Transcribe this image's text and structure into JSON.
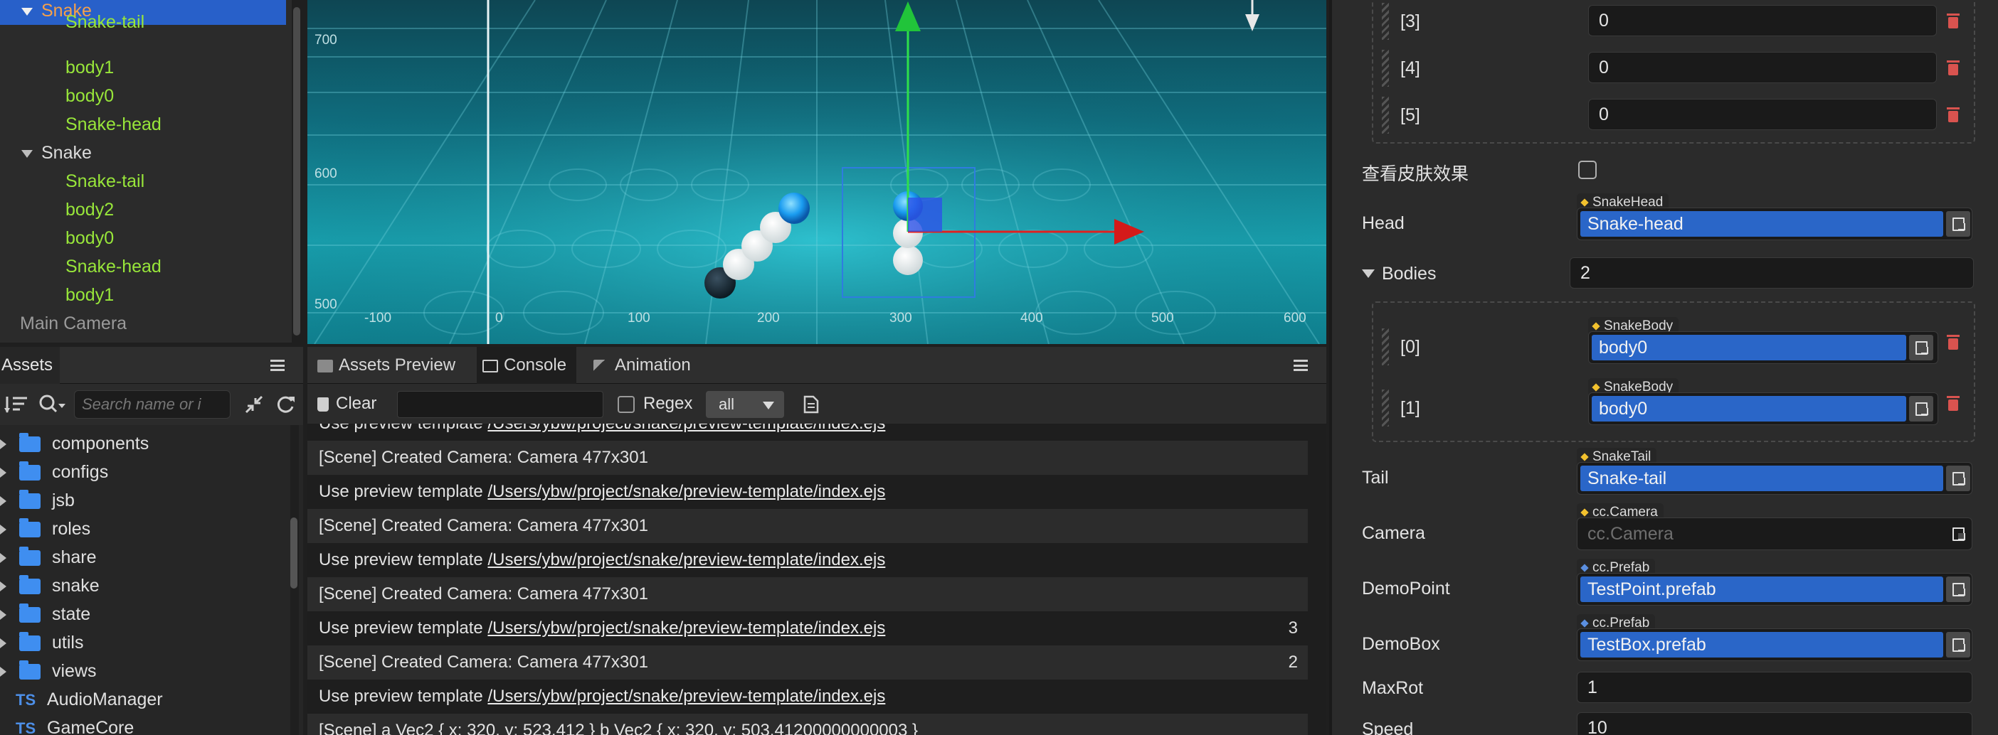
{
  "hierarchy": {
    "items": [
      {
        "label": "Snake",
        "color": "#f5a04a",
        "selected": true,
        "expanded": true
      },
      {
        "label": "Snake-tail",
        "color": "#98e63a"
      },
      {
        "label": "body1",
        "color": "#98e63a"
      },
      {
        "label": "body0",
        "color": "#98e63a"
      },
      {
        "label": "Snake-head",
        "color": "#98e63a"
      },
      {
        "label": "Snake",
        "color": "#dcdcdc",
        "expanded": true
      },
      {
        "label": "Snake-tail",
        "color": "#98e63a"
      },
      {
        "label": "body2",
        "color": "#98e63a"
      },
      {
        "label": "body0",
        "color": "#98e63a"
      },
      {
        "label": "Snake-head",
        "color": "#98e63a"
      },
      {
        "label": "body1",
        "color": "#98e63a"
      },
      {
        "label": "Main Camera",
        "color": "#9a9a9a"
      }
    ]
  },
  "scene": {
    "y_labels": [
      "700",
      "600",
      "500"
    ],
    "x_labels": [
      "-100",
      "0",
      "100",
      "200",
      "300",
      "400",
      "500",
      "600"
    ]
  },
  "assets": {
    "tab_label": "Assets",
    "search_placeholder": "Search name or i",
    "items": [
      {
        "label": "components",
        "kind": "folder"
      },
      {
        "label": "configs",
        "kind": "folder"
      },
      {
        "label": "jsb",
        "kind": "folder"
      },
      {
        "label": "roles",
        "kind": "folder"
      },
      {
        "label": "share",
        "kind": "folder"
      },
      {
        "label": "snake",
        "kind": "folder"
      },
      {
        "label": "state",
        "kind": "folder"
      },
      {
        "label": "utils",
        "kind": "folder"
      },
      {
        "label": "views",
        "kind": "folder"
      },
      {
        "label": "AudioManager",
        "kind": "ts"
      },
      {
        "label": "GameCore",
        "kind": "ts"
      }
    ],
    "ts_badge": "TS"
  },
  "console": {
    "tabs": {
      "assets_preview": "Assets Preview",
      "console": "Console",
      "animation": "Animation"
    },
    "toolbar": {
      "clear_label": "Clear",
      "regex_label": "Regex",
      "level_value": "all"
    },
    "lines": [
      {
        "text": "Use preview template ",
        "link": "/Users/ybw/project/snake/preview-template/index.ejs",
        "count": ""
      },
      {
        "text": "[Scene] Created Camera: Camera 477x301",
        "link": "",
        "count": ""
      },
      {
        "text": "Use preview template ",
        "link": "/Users/ybw/project/snake/preview-template/index.ejs",
        "count": ""
      },
      {
        "text": "[Scene] Created Camera: Camera 477x301",
        "link": "",
        "count": ""
      },
      {
        "text": "Use preview template ",
        "link": "/Users/ybw/project/snake/preview-template/index.ejs",
        "count": ""
      },
      {
        "text": "[Scene] Created Camera: Camera 477x301",
        "link": "",
        "count": ""
      },
      {
        "text": "Use preview template ",
        "link": "/Users/ybw/project/snake/preview-template/index.ejs",
        "count": "3"
      },
      {
        "text": "[Scene] Created Camera: Camera 477x301",
        "link": "",
        "count": "2"
      },
      {
        "text": "Use preview template ",
        "link": "/Users/ybw/project/snake/preview-template/index.ejs",
        "count": ""
      },
      {
        "text": "[Scene] a Vec2 { x: 320, y: 523.412 } b Vec2 { x: 320, y: 503.41200000000003 }",
        "link": "",
        "count": ""
      }
    ]
  },
  "inspector": {
    "array_items": [
      {
        "index": "[3]",
        "value": "0"
      },
      {
        "index": "[4]",
        "value": "0"
      },
      {
        "index": "[5]",
        "value": "0"
      }
    ],
    "skin_preview_label": "查看皮肤效果",
    "head": {
      "label": "Head",
      "type": "SnakeHead",
      "value": "Snake-head"
    },
    "bodies": {
      "label": "Bodies",
      "count": "2",
      "items": [
        {
          "index": "[0]",
          "type": "SnakeBody",
          "value": "body0"
        },
        {
          "index": "[1]",
          "type": "SnakeBody",
          "value": "body0"
        }
      ]
    },
    "tail": {
      "label": "Tail",
      "type": "SnakeTail",
      "value": "Snake-tail"
    },
    "camera": {
      "label": "Camera",
      "type": "cc.Camera",
      "placeholder": "cc.Camera"
    },
    "demo_point": {
      "label": "DemoPoint",
      "type": "cc.Prefab",
      "value": "TestPoint.prefab"
    },
    "demo_box": {
      "label": "DemoBox",
      "type": "cc.Prefab",
      "value": "TestBox.prefab"
    },
    "max_rot": {
      "label": "MaxRot",
      "value": "1"
    },
    "speed": {
      "label": "Speed",
      "value": "10"
    }
  },
  "colors": {
    "selection": "#2860c9",
    "node_green": "#98e63a",
    "node_orange": "#f5a04a",
    "reference_blue": "#2a66c8",
    "delete_red": "#d9534f"
  }
}
